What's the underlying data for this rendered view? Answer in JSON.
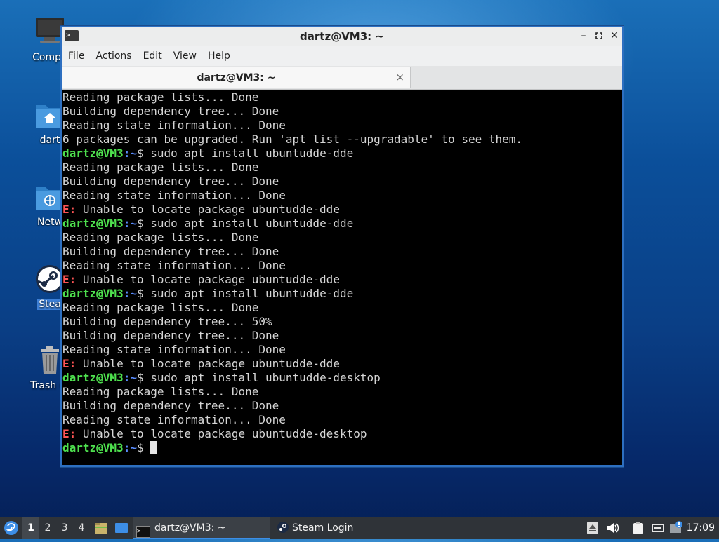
{
  "desktop": {
    "icons": [
      {
        "label": "Compu",
        "icon": "computer-icon"
      },
      {
        "label": "dart",
        "icon": "home-folder-icon"
      },
      {
        "label": "Netw",
        "icon": "network-folder-icon"
      },
      {
        "label": "Stea",
        "icon": "steam-icon"
      },
      {
        "label": "Trash (E",
        "icon": "trash-icon"
      }
    ]
  },
  "window": {
    "title": "dartz@VM3: ~",
    "menu": [
      "File",
      "Actions",
      "Edit",
      "View",
      "Help"
    ],
    "tab_label": "dartz@VM3: ~",
    "tab_close": "×"
  },
  "terminal": {
    "prompt_user": "dartz@VM3",
    "prompt_path": ":~",
    "prompt_symbol": "$",
    "lines": [
      {
        "type": "out",
        "text": "Reading package lists... Done"
      },
      {
        "type": "out",
        "text": "Building dependency tree... Done"
      },
      {
        "type": "out",
        "text": "Reading state information... Done"
      },
      {
        "type": "out",
        "text": "6 packages can be upgraded. Run 'apt list --upgradable' to see them."
      },
      {
        "type": "cmd",
        "text": " sudo apt install ubuntudde-dde"
      },
      {
        "type": "out",
        "text": "Reading package lists... Done"
      },
      {
        "type": "out",
        "text": "Building dependency tree... Done"
      },
      {
        "type": "out",
        "text": "Reading state information... Done"
      },
      {
        "type": "err",
        "prefix": "E:",
        "text": " Unable to locate package ubuntudde-dde"
      },
      {
        "type": "cmd",
        "text": " sudo apt install ubuntudde-dde"
      },
      {
        "type": "out",
        "text": "Reading package lists... Done"
      },
      {
        "type": "out",
        "text": "Building dependency tree... Done"
      },
      {
        "type": "out",
        "text": "Reading state information... Done"
      },
      {
        "type": "err",
        "prefix": "E:",
        "text": " Unable to locate package ubuntudde-dde"
      },
      {
        "type": "cmd",
        "text": " sudo apt install ubuntudde-dde"
      },
      {
        "type": "out",
        "text": "Reading package lists... Done"
      },
      {
        "type": "out",
        "text": "Building dependency tree... 50%"
      },
      {
        "type": "out",
        "text": "Building dependency tree... Done"
      },
      {
        "type": "out",
        "text": "Reading state information... Done"
      },
      {
        "type": "err",
        "prefix": "E:",
        "text": " Unable to locate package ubuntudde-dde"
      },
      {
        "type": "cmd",
        "text": " sudo apt install ubuntudde-desktop"
      },
      {
        "type": "out",
        "text": "Reading package lists... Done"
      },
      {
        "type": "out",
        "text": "Building dependency tree... Done"
      },
      {
        "type": "out",
        "text": "Reading state information... Done"
      },
      {
        "type": "err",
        "prefix": "E:",
        "text": " Unable to locate package ubuntudde-desktop"
      },
      {
        "type": "prompt",
        "text": " "
      }
    ]
  },
  "taskbar": {
    "workspaces": [
      "1",
      "2",
      "3",
      "4"
    ],
    "active_workspace": "1",
    "tasks": [
      {
        "label": "dartz@VM3: ~",
        "icon": "terminal-icon"
      },
      {
        "label": "Steam Login",
        "icon": "steam-icon"
      }
    ],
    "tray_icons": [
      "eject-icon",
      "volume-icon",
      "clipboard-icon",
      "network-icon",
      "update-notifier-icon"
    ],
    "clock": "17:09"
  },
  "colors": {
    "prompt_user": "#4ee04e",
    "prompt_path": "#5a8dff",
    "error": "#ff5555",
    "accent": "#3d8ee6"
  }
}
